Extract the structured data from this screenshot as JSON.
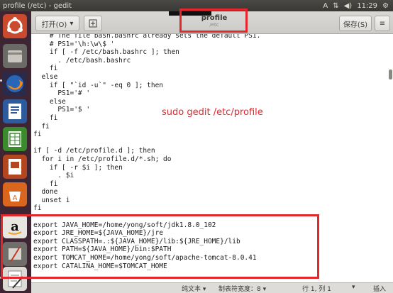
{
  "top_panel": {
    "window_title": "profile (/etc) - gedit",
    "indicators": {
      "input": "A",
      "sort": "⇅",
      "volume": "◀)",
      "clock": "11:29",
      "gear": "⚙"
    }
  },
  "toolbar": {
    "open_label": "打开(O)",
    "open_arrow": "▾",
    "new_tab_icon": "+",
    "save_label": "保存(S)",
    "menu_icon": "≡",
    "tab_title": "profile",
    "tab_path": "/etc"
  },
  "editor": {
    "lines": [
      "    # The file bash.bashrc already sets the default PS1.",
      "    # PS1='\\h:\\w\\$ '",
      "    if [ -f /etc/bash.bashrc ]; then",
      "      . /etc/bash.bashrc",
      "    fi",
      "  else",
      "    if [ \"`id -u`\" -eq 0 ]; then",
      "      PS1='# '",
      "    else",
      "      PS1='$ '",
      "    fi",
      "  fi",
      "fi",
      "",
      "if [ -d /etc/profile.d ]; then",
      "  for i in /etc/profile.d/*.sh; do",
      "    if [ -r $i ]; then",
      "      . $i",
      "    fi",
      "  done",
      "  unset i",
      "fi",
      "",
      "export JAVA_HOME=/home/yong/soft/jdk1.8.0_102",
      "export JRE_HOME=${JAVA_HOME}/jre",
      "export CLASSPATH=.:${JAVA_HOME}/lib:${JRE_HOME}/lib",
      "export PATH=${JAVA_HOME}/bin:$PATH",
      "export TOMCAT_HOME=/home/yong/soft/apache-tomcat-8.0.41",
      "export CATALINA_HOME=$TOMCAT_HOME"
    ],
    "annotation": "sudo gedit /etc/profile"
  },
  "statusbar": {
    "language": "纯文本 ▾",
    "tab_width": "制表符宽度：8 ▾",
    "position": "行 1, 列 1",
    "mode_arrow": "▾",
    "insert_mode": "插入"
  },
  "launcher": {
    "icons": [
      "ubuntu-logo",
      "files",
      "firefox",
      "writer",
      "calc",
      "impress",
      "software-center",
      "amazon",
      "settings",
      "gedit"
    ]
  }
}
